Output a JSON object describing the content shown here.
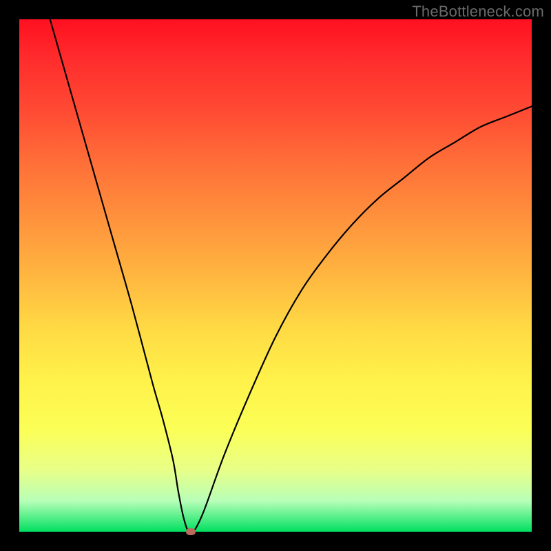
{
  "watermark": "TheBottleneck.com",
  "chart_data": {
    "type": "line",
    "title": "",
    "xlabel": "",
    "ylabel": "",
    "xlim": [
      0,
      100
    ],
    "ylim": [
      0,
      100
    ],
    "grid": false,
    "legend": false,
    "background_gradient": {
      "direction": "vertical",
      "stops": [
        {
          "pos": 0,
          "color": "#ff1020"
        },
        {
          "pos": 50,
          "color": "#ffb640"
        },
        {
          "pos": 80,
          "color": "#fbff56"
        },
        {
          "pos": 100,
          "color": "#00e060"
        }
      ]
    },
    "series": [
      {
        "name": "bottleneck-curve",
        "color": "#000000",
        "x": [
          6,
          10,
          14,
          18,
          22,
          26,
          28,
          30,
          31,
          32,
          33,
          34,
          36,
          40,
          45,
          50,
          55,
          60,
          65,
          70,
          75,
          80,
          85,
          90,
          95,
          100
        ],
        "y": [
          100,
          86,
          72,
          58,
          44,
          29,
          22,
          14,
          8,
          3,
          0,
          0,
          4,
          15,
          27,
          38,
          47,
          54,
          60,
          65,
          69,
          73,
          76,
          79,
          81,
          83
        ]
      }
    ],
    "marker": {
      "name": "optimal-point",
      "x": 33.5,
      "y": 0,
      "color": "#bb6b5c"
    }
  }
}
